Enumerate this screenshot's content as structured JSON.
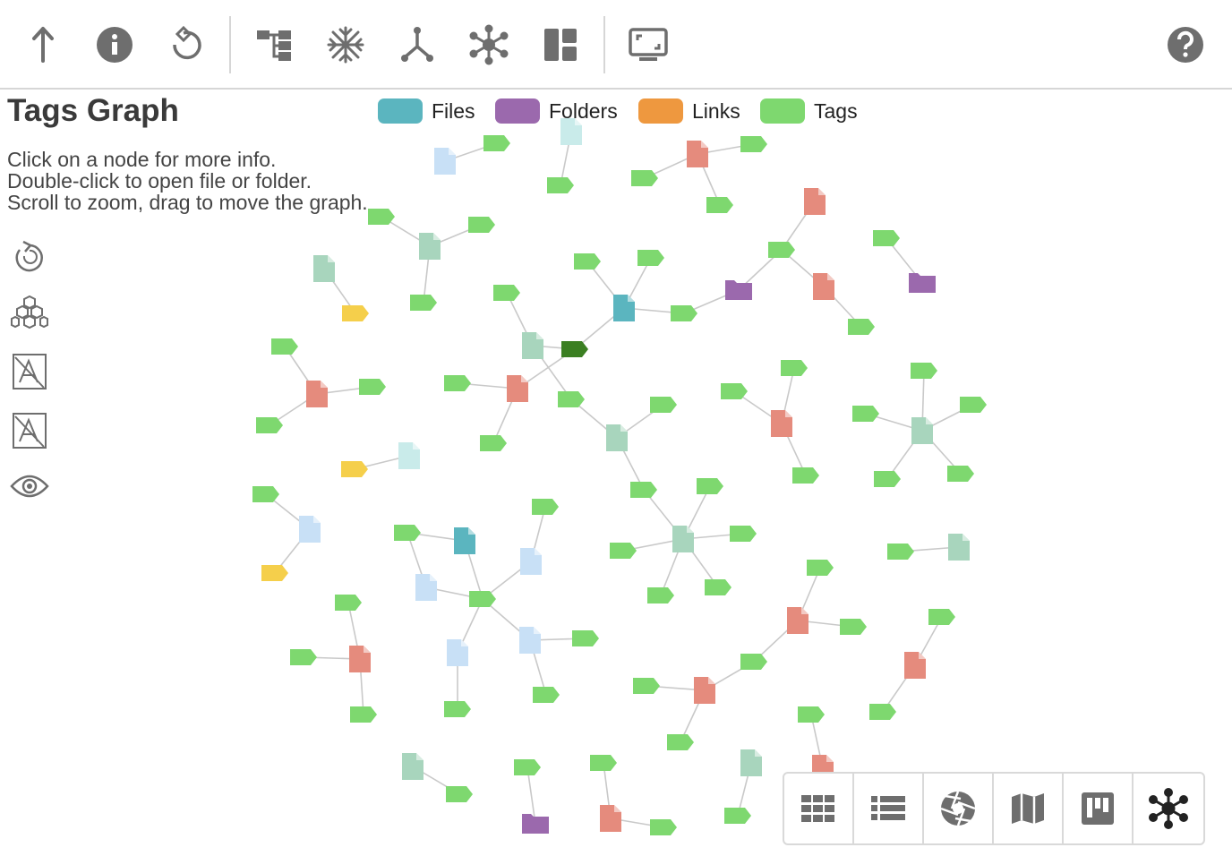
{
  "toolbar": {
    "buttons": [
      "go-up",
      "info",
      "reset",
      "tree-view",
      "freeze",
      "branch",
      "network",
      "layout",
      "presentation",
      "help"
    ]
  },
  "panel": {
    "title": "Tags Graph",
    "help_lines": [
      "Click on a node for more info.",
      "Double-click to open file or folder.",
      "Scroll to zoom, drag to move the graph."
    ]
  },
  "legend": [
    {
      "label": "Files",
      "color": "#5bb5bf"
    },
    {
      "label": "Folders",
      "color": "#9b69ad"
    },
    {
      "label": "Links",
      "color": "#ee983f"
    },
    {
      "label": "Tags",
      "color": "#7ed86f"
    }
  ],
  "colors": {
    "tag": "#7ed86f",
    "tag_selected": "#3b7f22",
    "tag_yellow": "#f5cf4b",
    "file_teal": "#5bb5bf",
    "file_red": "#e58b7d",
    "file_mint": "#a8d5bd",
    "file_blue": "#c8e0f6",
    "file_cyan": "#c9ebea",
    "folder": "#9b69ad",
    "icon_gray": "#6e6e6e"
  },
  "side_tools": [
    "refresh-layout",
    "hexagon-cluster",
    "hide-labels",
    "hide-tags-labels",
    "show-hidden"
  ],
  "view_modes": [
    "grid-view",
    "list-view",
    "gallery-view",
    "map-view",
    "kanban-view",
    "graph-view"
  ],
  "active_view": "graph-view"
}
